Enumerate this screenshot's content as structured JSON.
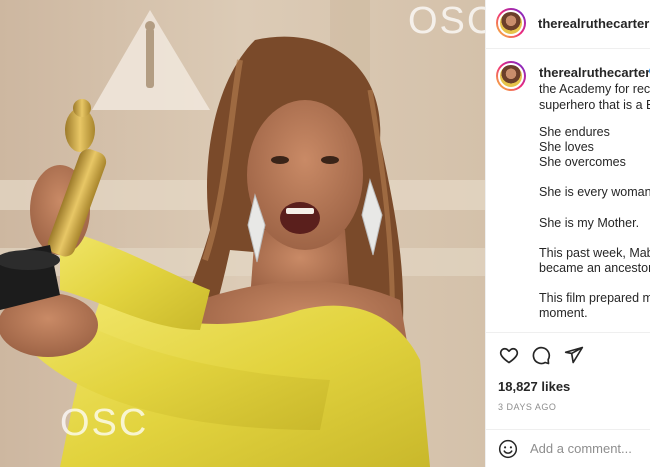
{
  "photo": {
    "backdrop_text_top": "OSC",
    "backdrop_text_bottom": "OSC"
  },
  "post": {
    "username": "therealruthecarter",
    "caption_lines": [
      "the Academy for reco",
      "superhero that is a B",
      "She endures",
      "She loves",
      "She overcomes",
      "She is every woman",
      "She is my Mother.",
      "This past week, Mab",
      "became an ancestor.",
      "This film prepared m",
      "moment."
    ],
    "likes": "18,827 likes",
    "timestamp": "3 DAYS AGO",
    "comment_placeholder": "Add a comment..."
  },
  "colors": {
    "text": "#262626",
    "muted": "#8e8e8e",
    "divider": "#efefef",
    "verified": "#3897f0",
    "dress": "#e6d94a"
  },
  "icons": [
    "heart-icon",
    "comment-icon",
    "share-icon",
    "emoji-icon",
    "verified-badge-icon"
  ]
}
